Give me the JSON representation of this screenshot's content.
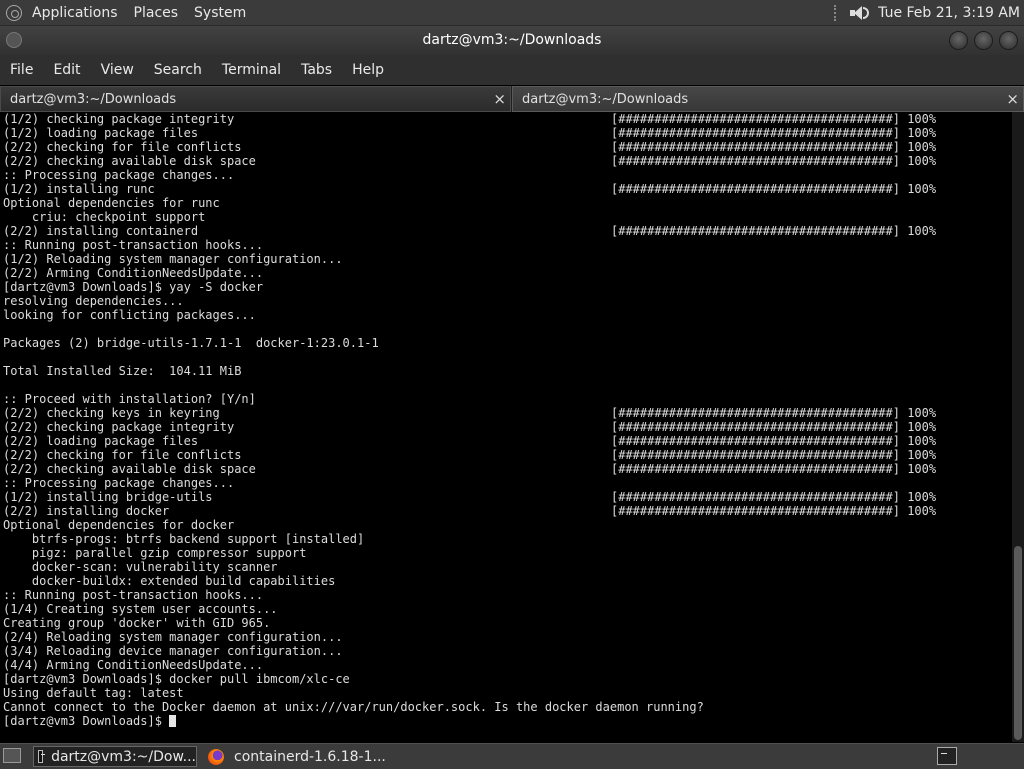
{
  "top_panel": {
    "menus": [
      "Applications",
      "Places",
      "System"
    ],
    "clock": "Tue Feb 21, 3:19 AM"
  },
  "window": {
    "title": "dartz@vm3:~/Downloads"
  },
  "menubar": {
    "items": [
      "File",
      "Edit",
      "View",
      "Search",
      "Terminal",
      "Tabs",
      "Help"
    ]
  },
  "tabs": [
    {
      "label": "dartz@vm3:~/Downloads"
    },
    {
      "label": "dartz@vm3:~/Downloads"
    }
  ],
  "terminal": {
    "lines": [
      {
        "text": "(1/2) checking package integrity",
        "bar": "[######################################] 100%"
      },
      {
        "text": "(1/2) loading package files",
        "bar": "[######################################] 100%"
      },
      {
        "text": "(2/2) checking for file conflicts",
        "bar": "[######################################] 100%"
      },
      {
        "text": "(2/2) checking available disk space",
        "bar": "[######################################] 100%"
      },
      {
        "text": ":: Processing package changes..."
      },
      {
        "text": "(1/2) installing runc",
        "bar": "[######################################] 100%"
      },
      {
        "text": "Optional dependencies for runc"
      },
      {
        "text": "    criu: checkpoint support"
      },
      {
        "text": "(2/2) installing containerd",
        "bar": "[######################################] 100%"
      },
      {
        "text": ":: Running post-transaction hooks..."
      },
      {
        "text": "(1/2) Reloading system manager configuration..."
      },
      {
        "text": "(2/2) Arming ConditionNeedsUpdate..."
      },
      {
        "text": "[dartz@vm3 Downloads]$ yay -S docker"
      },
      {
        "text": "resolving dependencies..."
      },
      {
        "text": "looking for conflicting packages..."
      },
      {
        "text": ""
      },
      {
        "text": "Packages (2) bridge-utils-1.7.1-1  docker-1:23.0.1-1"
      },
      {
        "text": ""
      },
      {
        "text": "Total Installed Size:  104.11 MiB"
      },
      {
        "text": ""
      },
      {
        "text": ":: Proceed with installation? [Y/n]"
      },
      {
        "text": "(2/2) checking keys in keyring",
        "bar": "[######################################] 100%"
      },
      {
        "text": "(2/2) checking package integrity",
        "bar": "[######################################] 100%"
      },
      {
        "text": "(2/2) loading package files",
        "bar": "[######################################] 100%"
      },
      {
        "text": "(2/2) checking for file conflicts",
        "bar": "[######################################] 100%"
      },
      {
        "text": "(2/2) checking available disk space",
        "bar": "[######################################] 100%"
      },
      {
        "text": ":: Processing package changes..."
      },
      {
        "text": "(1/2) installing bridge-utils",
        "bar": "[######################################] 100%"
      },
      {
        "text": "(2/2) installing docker",
        "bar": "[######################################] 100%"
      },
      {
        "text": "Optional dependencies for docker"
      },
      {
        "text": "    btrfs-progs: btrfs backend support [installed]"
      },
      {
        "text": "    pigz: parallel gzip compressor support"
      },
      {
        "text": "    docker-scan: vulnerability scanner"
      },
      {
        "text": "    docker-buildx: extended build capabilities"
      },
      {
        "text": ":: Running post-transaction hooks..."
      },
      {
        "text": "(1/4) Creating system user accounts..."
      },
      {
        "text": "Creating group 'docker' with GID 965."
      },
      {
        "text": "(2/4) Reloading system manager configuration..."
      },
      {
        "text": "(3/4) Reloading device manager configuration..."
      },
      {
        "text": "(4/4) Arming ConditionNeedsUpdate..."
      },
      {
        "text": "[dartz@vm3 Downloads]$ docker pull ibmcom/xlc-ce"
      },
      {
        "text": "Using default tag: latest"
      },
      {
        "text": "Cannot connect to the Docker daemon at unix:///var/run/docker.sock. Is the docker daemon running?"
      }
    ],
    "prompt": "[dartz@vm3 Downloads]$ "
  },
  "taskbar": {
    "tasks": [
      {
        "label": "dartz@vm3:~/Dow...",
        "icon": "terminal-icon",
        "active": true
      },
      {
        "label": "containerd-1.6.18-1...",
        "icon": "firefox-icon",
        "active": false
      }
    ]
  }
}
